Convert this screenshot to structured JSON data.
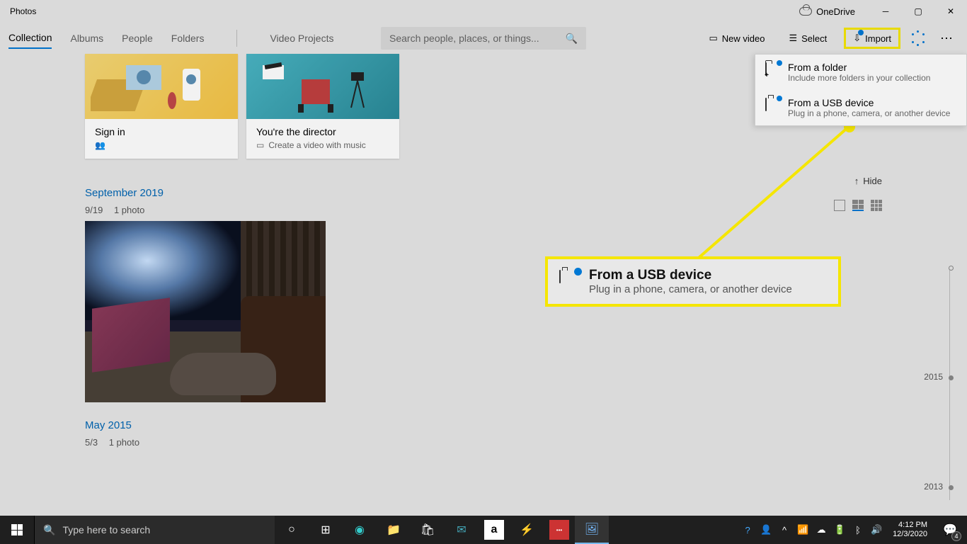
{
  "titlebar": {
    "app": "Photos",
    "onedrive": "OneDrive"
  },
  "tabs": {
    "collection": "Collection",
    "albums": "Albums",
    "people": "People",
    "folders": "Folders",
    "video": "Video Projects"
  },
  "search": {
    "placeholder": "Search people, places, or things..."
  },
  "actions": {
    "newvideo": "New video",
    "select": "Select",
    "import": "Import"
  },
  "dropdown": {
    "folder_t": "From a folder",
    "folder_s": "Include more folders in your collection",
    "usb_t": "From a USB device",
    "usb_s": "Plug in a phone, camera, or another device"
  },
  "cards": {
    "signin_t": "Sign in",
    "director_t": "You're the director",
    "director_s": "Create a video with music"
  },
  "view": {
    "hide": "Hide"
  },
  "sections": {
    "sep2019": "September 2019",
    "sep2019_date": "9/19",
    "sep2019_count": "1 photo",
    "may2015": "May 2015",
    "may2015_date": "5/3",
    "may2015_count": "1 photo"
  },
  "timeline": {
    "y2015": "2015",
    "y2013": "2013"
  },
  "callout": {
    "t": "From a USB device",
    "s": "Plug in a phone, camera, or another device"
  },
  "taskbar": {
    "search": "Type here to search",
    "time": "4:12 PM",
    "date": "12/3/2020",
    "notif_count": "4"
  }
}
